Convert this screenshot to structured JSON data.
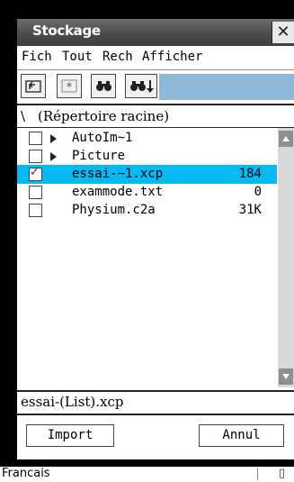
{
  "window": {
    "title": "Stockage",
    "close_glyph": "✕"
  },
  "menubar": {
    "items": [
      "Fich",
      "Tout",
      "Rech",
      "Afficher"
    ]
  },
  "toolbar": {
    "buttons": [
      "parent-folder-icon",
      "asterisk-icon",
      "binoculars-search-icon",
      "binoculars-next-icon"
    ]
  },
  "path": {
    "backslash": "\\",
    "label": "(Répertoire racine)"
  },
  "files": [
    {
      "name": "AutoIm~1",
      "size": "",
      "folder": true,
      "checked": false,
      "selected": false
    },
    {
      "name": "Picture",
      "size": "",
      "folder": true,
      "checked": false,
      "selected": false
    },
    {
      "name": "essai-~1.xcp",
      "size": "184",
      "folder": false,
      "checked": true,
      "selected": true
    },
    {
      "name": "exammode.txt",
      "size": "0",
      "folder": false,
      "checked": false,
      "selected": false
    },
    {
      "name": "Physium.c2a",
      "size": "31K",
      "folder": false,
      "checked": false,
      "selected": false
    }
  ],
  "filename_field": {
    "value": "essai-(List).xcp"
  },
  "buttons": {
    "import": "Import",
    "cancel": "Annul"
  },
  "status": {
    "language": "Francais"
  },
  "colors": {
    "selection": "#06b9f0",
    "toolbar_strip": "#8db8d7",
    "titlebar": "#555555"
  }
}
